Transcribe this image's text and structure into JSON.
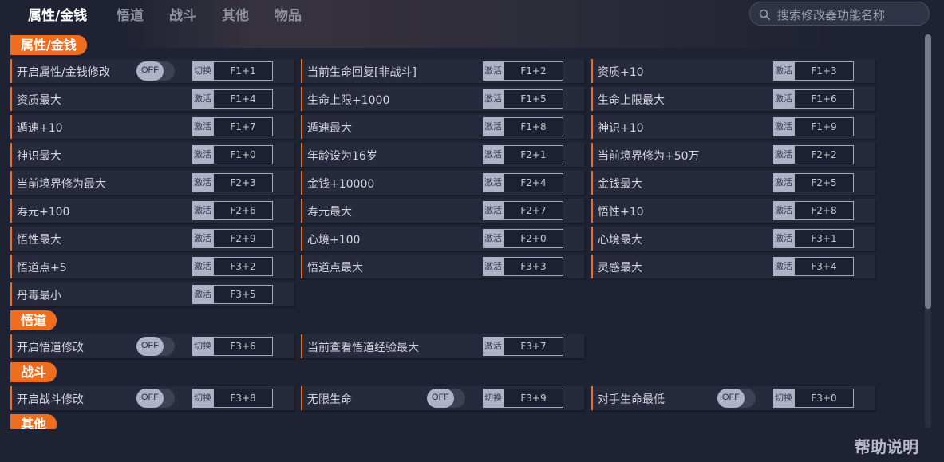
{
  "tabs": [
    {
      "label": "属性/金钱",
      "active": true
    },
    {
      "label": "悟道",
      "active": false
    },
    {
      "label": "战斗",
      "active": false
    },
    {
      "label": "其他",
      "active": false
    },
    {
      "label": "物品",
      "active": false
    }
  ],
  "search": {
    "placeholder": "搜索修改器功能名称",
    "value": ""
  },
  "sections": [
    {
      "title": "属性/金钱",
      "rows": [
        {
          "label": "开启属性/金钱修改",
          "toggle": "OFF",
          "type": "切换",
          "key": "F1+1"
        },
        {
          "label": "当前生命回复[非战斗]",
          "type": "激活",
          "key": "F1+2"
        },
        {
          "label": "资质+10",
          "type": "激活",
          "key": "F1+3"
        },
        {
          "label": "资质最大",
          "type": "激活",
          "key": "F1+4"
        },
        {
          "label": "生命上限+1000",
          "type": "激活",
          "key": "F1+5"
        },
        {
          "label": "生命上限最大",
          "type": "激活",
          "key": "F1+6"
        },
        {
          "label": "遁速+10",
          "type": "激活",
          "key": "F1+7"
        },
        {
          "label": "遁速最大",
          "type": "激活",
          "key": "F1+8"
        },
        {
          "label": "神识+10",
          "type": "激活",
          "key": "F1+9"
        },
        {
          "label": "神识最大",
          "type": "激活",
          "key": "F1+0"
        },
        {
          "label": "年龄设为16岁",
          "type": "激活",
          "key": "F2+1"
        },
        {
          "label": "当前境界修为+50万",
          "type": "激活",
          "key": "F2+2"
        },
        {
          "label": "当前境界修为最大",
          "type": "激活",
          "key": "F2+3"
        },
        {
          "label": "金钱+10000",
          "type": "激活",
          "key": "F2+4"
        },
        {
          "label": "金钱最大",
          "type": "激活",
          "key": "F2+5"
        },
        {
          "label": "寿元+100",
          "type": "激活",
          "key": "F2+6"
        },
        {
          "label": "寿元最大",
          "type": "激活",
          "key": "F2+7"
        },
        {
          "label": "悟性+10",
          "type": "激活",
          "key": "F2+8"
        },
        {
          "label": "悟性最大",
          "type": "激活",
          "key": "F2+9"
        },
        {
          "label": "心境+100",
          "type": "激活",
          "key": "F2+0"
        },
        {
          "label": "心境最大",
          "type": "激活",
          "key": "F3+1"
        },
        {
          "label": "悟道点+5",
          "type": "激活",
          "key": "F3+2"
        },
        {
          "label": "悟道点最大",
          "type": "激活",
          "key": "F3+3"
        },
        {
          "label": "灵感最大",
          "type": "激活",
          "key": "F3+4"
        },
        {
          "label": "丹毒最小",
          "type": "激活",
          "key": "F3+5"
        }
      ]
    },
    {
      "title": "悟道",
      "rows": [
        {
          "label": "开启悟道修改",
          "toggle": "OFF",
          "type": "切换",
          "key": "F3+6"
        },
        {
          "label": "当前查看悟道经验最大",
          "type": "激活",
          "key": "F3+7"
        }
      ]
    },
    {
      "title": "战斗",
      "rows": [
        {
          "label": "开启战斗修改",
          "toggle": "OFF",
          "type": "切换",
          "key": "F3+8"
        },
        {
          "label": "无限生命",
          "toggle": "OFF",
          "type": "切换",
          "key": "F3+9"
        },
        {
          "label": "对手生命最低",
          "toggle": "OFF",
          "type": "切换",
          "key": "F3+0"
        }
      ]
    },
    {
      "title": "其他",
      "rows": []
    }
  ],
  "help_label": "帮助说明",
  "colors": {
    "accent": "#ee6d1e",
    "background": "#1f2233",
    "row": "#272a3c"
  }
}
